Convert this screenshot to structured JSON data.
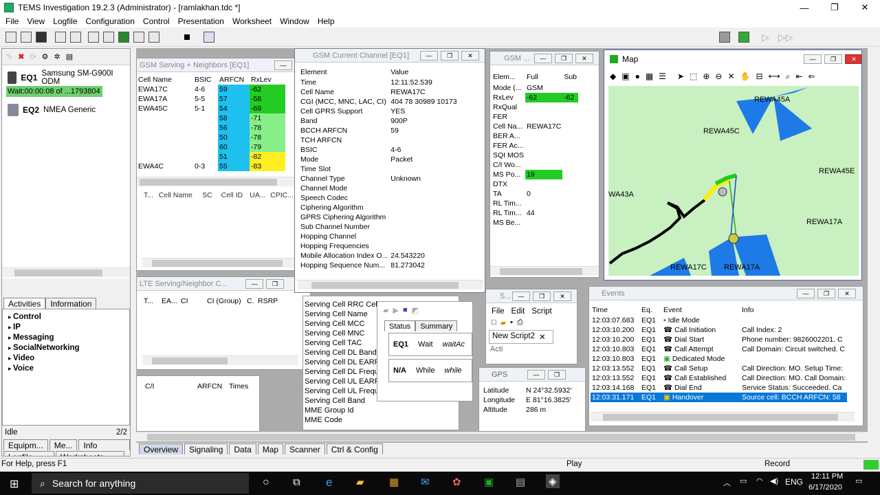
{
  "window": {
    "title": "TEMS Investigation 19.2.3 (Administrator) - [ramlakhan.tdc *]",
    "minimize": "—",
    "maximize": "❐",
    "close": "✕"
  },
  "menu": [
    "File",
    "View",
    "Logfile",
    "Configuration",
    "Control",
    "Presentation",
    "Worksheet",
    "Window",
    "Help"
  ],
  "equipment": {
    "eq1_label": "EQ1",
    "eq1_device": "Samsung SM-G900I ODM",
    "eq1_status": "Wait:00:00:08 of ...1793804",
    "eq2_label": "EQ2",
    "eq2_device": "NMEA Generic"
  },
  "left_tabs": {
    "activities": "Activities",
    "information": "Information"
  },
  "activities": [
    "Control",
    "IP",
    "Messaging",
    "SocialNetworking",
    "Video",
    "Voice"
  ],
  "left_status": {
    "idle": "Idle",
    "page": "2/2"
  },
  "left_bottom_tabs": [
    "Equipm...",
    "Me...",
    "Info Elem...",
    "Logfile",
    "Worksheets"
  ],
  "gsm_serving": {
    "title": "GSM Serving + Neighbors [EQ1]",
    "headers": [
      "Cell Name",
      "BSIC",
      "ARFCN",
      "RxLev"
    ],
    "rows": [
      {
        "cell": "EWA17C",
        "bsic": "4-6",
        "arfcn": "59",
        "rxlev": "-62"
      },
      {
        "cell": "EWA17A",
        "bsic": "5-5",
        "arfcn": "57",
        "rxlev": "-58"
      },
      {
        "cell": "EWA45C",
        "bsic": "5-1",
        "arfcn": "54",
        "rxlev": "-69"
      },
      {
        "cell": "",
        "bsic": "",
        "arfcn": "58",
        "rxlev": "-71"
      },
      {
        "cell": "",
        "bsic": "",
        "arfcn": "56",
        "rxlev": "-78"
      },
      {
        "cell": "",
        "bsic": "",
        "arfcn": "50",
        "rxlev": "-78"
      },
      {
        "cell": "",
        "bsic": "",
        "arfcn": "60",
        "rxlev": "-79"
      },
      {
        "cell": "",
        "bsic": "",
        "arfcn": "51",
        "rxlev": "-82"
      },
      {
        "cell": "EWA4C",
        "bsic": "0-3",
        "arfcn": "55",
        "rxlev": "-83"
      }
    ],
    "sub_headers": [
      "T...",
      "Cell Name",
      "SC",
      "Cell ID",
      "UA...",
      "CPIC..."
    ]
  },
  "lte_serving": {
    "title": "LTE Serving/Neighbor C...",
    "headers": [
      "T...",
      "EA...",
      "CI",
      "CI (Group)",
      "C.",
      "RSRP"
    ]
  },
  "ci_pane": {
    "headers": [
      "C/I",
      "ARFCN",
      "Times"
    ]
  },
  "gsm_current": {
    "title": "GSM Current Channel [EQ1]",
    "col_element": "Element",
    "col_value": "Value",
    "rows": [
      {
        "e": "Time",
        "v": "12:11:52.539"
      },
      {
        "e": "Cell Name",
        "v": "REWA17C"
      },
      {
        "e": "CGI (MCC, MNC, LAC, CI)",
        "v": "404 78 30989 10173"
      },
      {
        "e": "Cell GPRS Support",
        "v": "YES"
      },
      {
        "e": "Band",
        "v": "900P"
      },
      {
        "e": "BCCH ARFCN",
        "v": "59"
      },
      {
        "e": "TCH ARFCN",
        "v": ""
      },
      {
        "e": "BSIC",
        "v": "4-6"
      },
      {
        "e": "Mode",
        "v": "Packet"
      },
      {
        "e": "Time Slot",
        "v": ""
      },
      {
        "e": "Channel Type",
        "v": "Unknown"
      },
      {
        "e": "Channel Mode",
        "v": ""
      },
      {
        "e": "Speech Codec",
        "v": ""
      },
      {
        "e": "Ciphering Algorithm",
        "v": ""
      },
      {
        "e": "GPRS Ciphering Algorithm",
        "v": ""
      },
      {
        "e": "Sub Channel Number",
        "v": ""
      },
      {
        "e": "Hopping Channel",
        "v": ""
      },
      {
        "e": "Hopping Frequencies",
        "v": ""
      },
      {
        "e": "Mobile Allocation Index O...",
        "v": "24.543220"
      },
      {
        "e": "Hopping Sequence Num...",
        "v": "81.273042"
      }
    ]
  },
  "lte_info": {
    "rows": [
      "Serving Cell RRC Cell I...",
      "Serving Cell Name",
      "Serving Cell MCC",
      "Serving Cell MNC",
      "Serving Cell TAC",
      "Serving Cell DL Bandw...",
      "Serving Cell DL EARFC...",
      "Serving Cell DL Freque...",
      "Serving Cell UL EARFC...",
      "Serving Cell UL Freque...",
      "Serving Cell Band",
      "MME Group Id",
      "MME Code"
    ]
  },
  "gsm_small": {
    "title": "GSM ...",
    "headers": [
      "Elem...",
      "Full",
      "Sub"
    ],
    "rows": [
      {
        "e": "Mode (...",
        "f": "GSM",
        "s": ""
      },
      {
        "e": "RxLev",
        "f": "-62",
        "s": "-62"
      },
      {
        "e": "RxQual",
        "f": "",
        "s": ""
      },
      {
        "e": "FER",
        "f": "",
        "s": ""
      },
      {
        "e": "Cell Na...",
        "f": "REWA17C",
        "s": ""
      },
      {
        "e": "BER A...",
        "f": "",
        "s": ""
      },
      {
        "e": "FER Ac...",
        "f": "",
        "s": ""
      },
      {
        "e": "SQI MOS",
        "f": "",
        "s": ""
      },
      {
        "e": "C/I Wo...",
        "f": "",
        "s": ""
      },
      {
        "e": "MS Po...",
        "f": "19",
        "s": ""
      },
      {
        "e": "DTX",
        "f": "",
        "s": ""
      },
      {
        "e": "TA",
        "f": "0",
        "s": ""
      },
      {
        "e": "RL Tim...",
        "f": "",
        "s": ""
      },
      {
        "e": "RL Tim...",
        "f": "44",
        "s": ""
      },
      {
        "e": "MS Be...",
        "f": "",
        "s": ""
      }
    ]
  },
  "map": {
    "title": "Map",
    "labels": [
      "REWA45A",
      "REWA45C",
      "REWA45E",
      "WA43A",
      "REWA17A",
      "REWA17C",
      "REWA17A"
    ]
  },
  "script": {
    "title": "S...",
    "menu": [
      "File",
      "Edit",
      "Script"
    ],
    "tab": "New Script2",
    "acti": "Acti"
  },
  "status_win": {
    "tabs": [
      "Status",
      "Summary"
    ],
    "rows": [
      {
        "eq": "EQ1",
        "state": "Wait",
        "act": "waitAc"
      },
      {
        "eq": "N/A",
        "state": "While",
        "act": "while"
      }
    ]
  },
  "gps": {
    "title": "GPS",
    "rows": [
      {
        "k": "Latitude",
        "v": "N 24°32.5932'"
      },
      {
        "k": "Longitude",
        "v": "E 81°16.3825'"
      },
      {
        "k": "Altitude",
        "v": "286 m"
      }
    ]
  },
  "events": {
    "title": "Events",
    "headers": [
      "Time",
      "Eq.",
      "Event",
      "Info"
    ],
    "rows": [
      {
        "t": "12:03:07.683",
        "eq": "EQ1",
        "ev": "Idle Mode",
        "info": ""
      },
      {
        "t": "12:03:10.200",
        "eq": "EQ1",
        "ev": "Call Initiation",
        "info": "Call Index: 2"
      },
      {
        "t": "12:03:10.200",
        "eq": "EQ1",
        "ev": "Dial Start",
        "info": "Phone number: 9826002201. C"
      },
      {
        "t": "12:03:10.803",
        "eq": "EQ1",
        "ev": "Call Attempt",
        "info": "Call Domain: Circuit switched. C"
      },
      {
        "t": "12:03:10.803",
        "eq": "EQ1",
        "ev": "Dedicated Mode",
        "info": ""
      },
      {
        "t": "12:03:13.552",
        "eq": "EQ1",
        "ev": "Call Setup",
        "info": "Call Direction: MO. Setup Time:"
      },
      {
        "t": "12:03:13.552",
        "eq": "EQ1",
        "ev": "Call Established",
        "info": "Call Direction: MO. Call Domain:"
      },
      {
        "t": "12:03:14.168",
        "eq": "EQ1",
        "ev": "Dial End",
        "info": "Service Status: Succeeded. Ca"
      },
      {
        "t": "12:03:31.171",
        "eq": "EQ1",
        "ev": "Handover",
        "info": "Source cell:  BCCH ARFCN: 58"
      }
    ]
  },
  "worksheet_tabs": [
    "Overview",
    "Signaling",
    "Data",
    "Map",
    "Scanner",
    "Ctrl & Config"
  ],
  "statusbar": {
    "help": "For Help, press F1",
    "play": "Play",
    "record": "Record"
  },
  "taskbar": {
    "search": "Search for anything",
    "lang": "ENG",
    "time": "12:11 PM",
    "date": "6/17/2020"
  }
}
